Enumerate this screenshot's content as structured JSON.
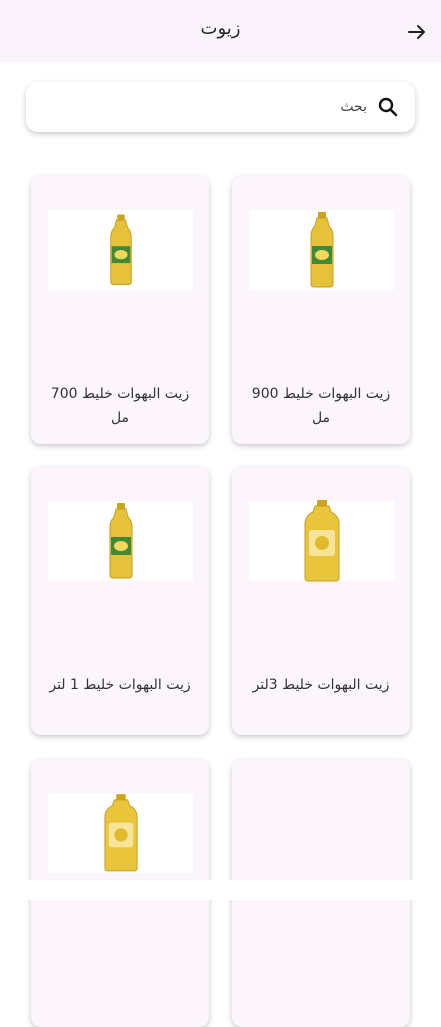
{
  "header": {
    "title": "زيوت",
    "back_icon": "arrow-right-icon"
  },
  "search": {
    "placeholder": "بحث",
    "icon": "search-icon"
  },
  "products": [
    {
      "name": "زيت البهوات خليط 900 مل",
      "image": "oil-bottle-icon"
    },
    {
      "name": "زيت البهوات خليط 700 مل",
      "image": "oil-bottle-icon"
    },
    {
      "name": "زيت البهوات خليط 3لتر",
      "image": "oil-jug-icon"
    },
    {
      "name": "زيت البهوات خليط 1 لتر",
      "image": "oil-bottle-icon"
    },
    {
      "name": "",
      "image": ""
    },
    {
      "name": "",
      "image": "oil-jug-icon"
    }
  ],
  "colors": {
    "appbar": "#fbf3fb",
    "card": "#fcf6fc",
    "oil": "#e8c53a"
  }
}
